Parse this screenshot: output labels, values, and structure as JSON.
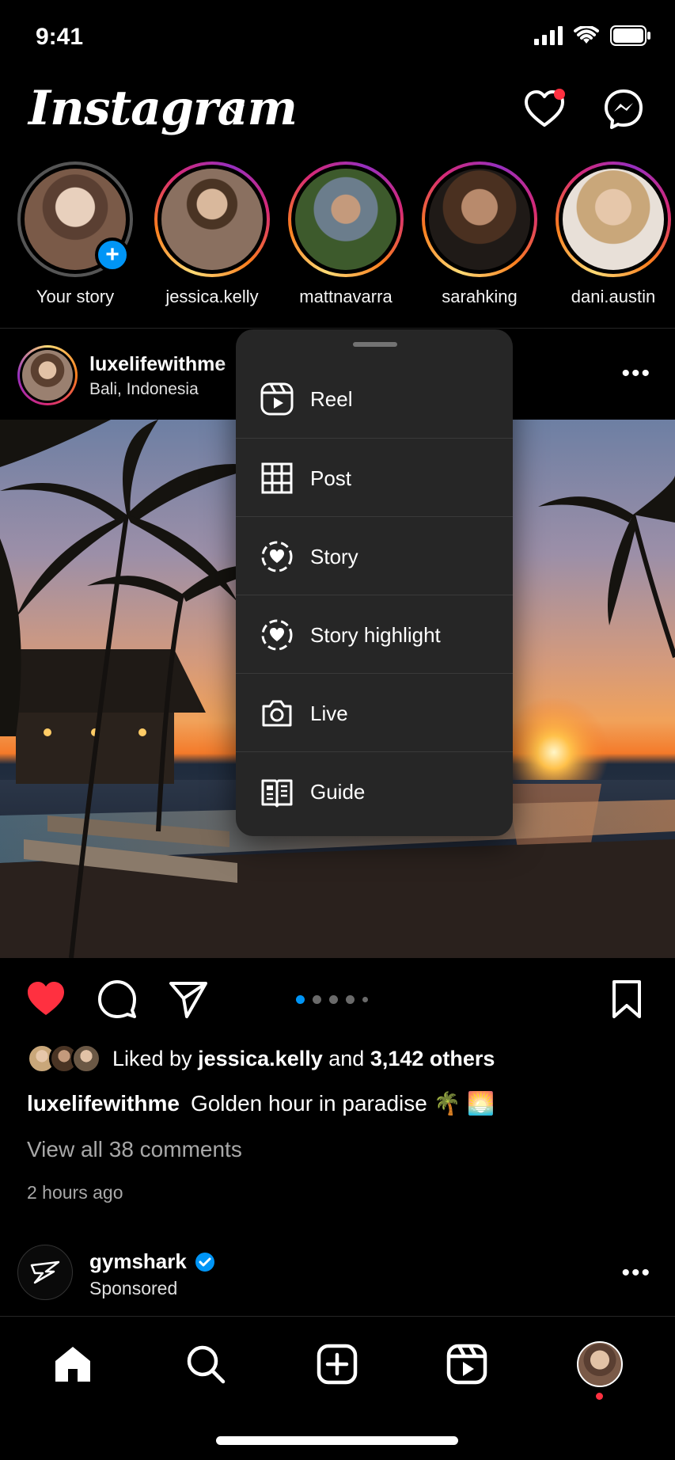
{
  "status_bar": {
    "time": "9:41"
  },
  "header": {
    "logo": "Instagram"
  },
  "stories": [
    {
      "name": "Your story",
      "own": true,
      "colors": [
        "#7a5a48",
        "#e8d0bd"
      ]
    },
    {
      "name": "jessica.kelly",
      "colors": [
        "#6b5845",
        "#cfb59c"
      ]
    },
    {
      "name": "mattnavarra",
      "colors": [
        "#3d5a2c",
        "#8b7a63"
      ]
    },
    {
      "name": "sarahking",
      "colors": [
        "#2a2420",
        "#a57a5c"
      ]
    },
    {
      "name": "dani.austin",
      "colors": [
        "#cbb8a4",
        "#f0dcc8"
      ]
    }
  ],
  "post": {
    "username": "luxelifewithme",
    "location": "Bali, Indonesia",
    "liked_by_prefix": "Liked by",
    "liked_by_user": "jessica.kelly",
    "liked_by_and": "and",
    "liked_by_others": "3,142 others",
    "caption_user": "luxelifewithme",
    "caption_text": "Golden hour in paradise 🌴 🌅",
    "comments_link": "View all 38 comments",
    "timestamp": "2 hours ago",
    "carousel_current": 1,
    "carousel_total": 5
  },
  "sponsored": {
    "name": "gymshark",
    "label": "Sponsored"
  },
  "create_menu": {
    "items": [
      {
        "label": "Reel",
        "icon": "reel-icon"
      },
      {
        "label": "Post",
        "icon": "grid-icon"
      },
      {
        "label": "Story",
        "icon": "story-icon"
      },
      {
        "label": "Story highlight",
        "icon": "story-highlight-icon"
      },
      {
        "label": "Live",
        "icon": "camera-icon"
      },
      {
        "label": "Guide",
        "icon": "guide-icon"
      }
    ]
  },
  "colors": {
    "accent": "#0095f6",
    "like": "#ff3040",
    "menu_bg": "#262626"
  }
}
